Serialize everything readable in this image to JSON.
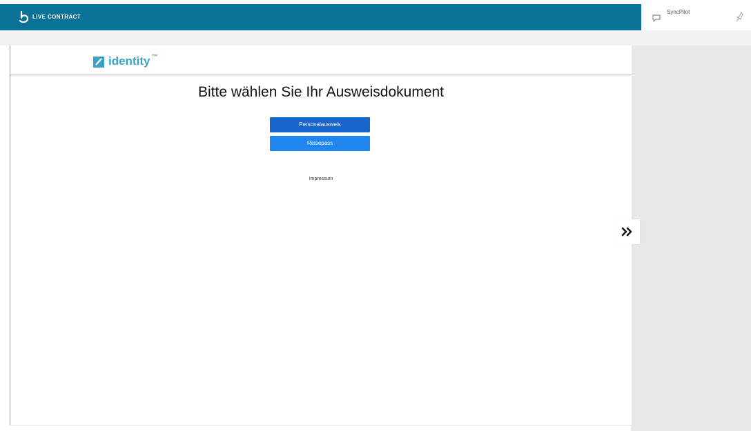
{
  "app": {
    "brand_name": "LIVE CONTRACT"
  },
  "header_right": {
    "label": "SyncPilot"
  },
  "identity": {
    "logo_text": "identity",
    "trademark": "™",
    "title": "Bitte wählen Sie Ihr Ausweisdokument",
    "buttons": [
      "Personalausweis",
      "Reisepass"
    ],
    "footer_link": "Impressum"
  },
  "icons": {
    "brand": "live-contract-logo-icon",
    "chat": "chat-icon",
    "pin": "pin-icon",
    "identity": "identity-check-icon",
    "expand": "double-chevron-right-icon"
  },
  "colors": {
    "topbar": "#0a7197",
    "identity_accent": "#3aa3c4",
    "button_primary": "#1666cc",
    "button_secondary": "#1f86f0",
    "side_panel": "#e8e8e8"
  }
}
